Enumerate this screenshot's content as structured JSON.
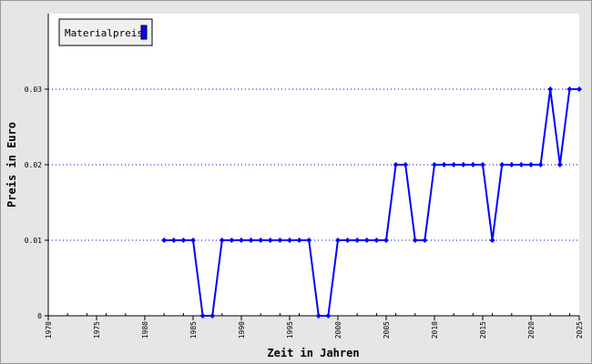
{
  "chart_data": {
    "type": "line",
    "xlabel": "Zeit in Jahren",
    "ylabel": "Preis in Euro",
    "xlim": [
      1970,
      2025
    ],
    "ylim": [
      0,
      0.04
    ],
    "x_ticks": [
      1970,
      1975,
      1980,
      1985,
      1990,
      1995,
      2000,
      2005,
      2010,
      2015,
      2020,
      2025
    ],
    "y_ticks": [
      {
        "value": 0,
        "label": "0"
      },
      {
        "value": 0.01,
        "label": "0.01"
      },
      {
        "value": 0.02,
        "label": "0.02"
      },
      {
        "value": 0.03,
        "label": "0.03"
      }
    ],
    "grid": "horizontal-dotted",
    "legend_position": "top-left",
    "series": [
      {
        "name": "Materialpreis",
        "color": "#0000ff",
        "x": [
          1982,
          1983,
          1984,
          1985,
          1986,
          1987,
          1988,
          1989,
          1990,
          1991,
          1992,
          1993,
          1994,
          1995,
          1996,
          1997,
          1998,
          1999,
          2000,
          2001,
          2002,
          2003,
          2004,
          2005,
          2006,
          2007,
          2008,
          2009,
          2010,
          2011,
          2012,
          2013,
          2014,
          2015,
          2016,
          2017,
          2018,
          2019,
          2020,
          2021,
          2022,
          2023,
          2024,
          2025
        ],
        "values": [
          0.01,
          0.01,
          0.01,
          0.01,
          0,
          0,
          0.01,
          0.01,
          0.01,
          0.01,
          0.01,
          0.01,
          0.01,
          0.01,
          0.01,
          0.01,
          0,
          0,
          0.01,
          0.01,
          0.01,
          0.01,
          0.01,
          0.01,
          0.02,
          0.02,
          0.01,
          0.01,
          0.02,
          0.02,
          0.02,
          0.02,
          0.02,
          0.02,
          0.01,
          0.02,
          0.02,
          0.02,
          0.02,
          0.02,
          0.03,
          0.02,
          0.03,
          0.03
        ]
      }
    ]
  }
}
